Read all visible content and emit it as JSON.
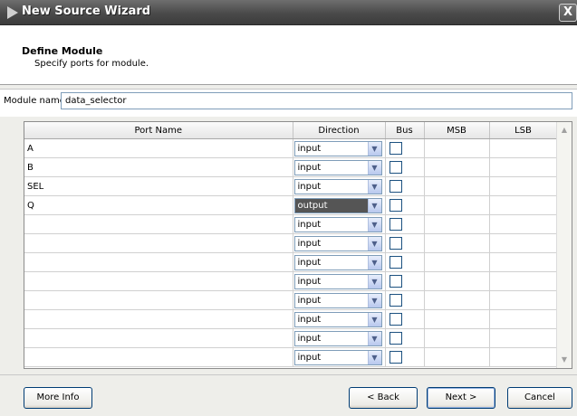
{
  "window": {
    "title": "New Source Wizard",
    "close_label": "X"
  },
  "header": {
    "title": "Define Module",
    "subtitle": "Specify ports for module."
  },
  "module_name": {
    "label": "Module name",
    "value": "data_selector"
  },
  "table": {
    "columns": [
      "Port Name",
      "Direction",
      "Bus",
      "MSB",
      "LSB"
    ],
    "rows": [
      {
        "port": "A",
        "direction": "input",
        "bus": false,
        "msb": "",
        "lsb": ""
      },
      {
        "port": "B",
        "direction": "input",
        "bus": false,
        "msb": "",
        "lsb": ""
      },
      {
        "port": "SEL",
        "direction": "input",
        "bus": false,
        "msb": "",
        "lsb": ""
      },
      {
        "port": "Q",
        "direction": "output",
        "bus": false,
        "msb": "",
        "lsb": "",
        "selected": true
      },
      {
        "port": "",
        "direction": "input",
        "bus": false,
        "msb": "",
        "lsb": ""
      },
      {
        "port": "",
        "direction": "input",
        "bus": false,
        "msb": "",
        "lsb": ""
      },
      {
        "port": "",
        "direction": "input",
        "bus": false,
        "msb": "",
        "lsb": ""
      },
      {
        "port": "",
        "direction": "input",
        "bus": false,
        "msb": "",
        "lsb": ""
      },
      {
        "port": "",
        "direction": "input",
        "bus": false,
        "msb": "",
        "lsb": ""
      },
      {
        "port": "",
        "direction": "input",
        "bus": false,
        "msb": "",
        "lsb": ""
      },
      {
        "port": "",
        "direction": "input",
        "bus": false,
        "msb": "",
        "lsb": ""
      },
      {
        "port": "",
        "direction": "input",
        "bus": false,
        "msb": "",
        "lsb": ""
      }
    ]
  },
  "buttons": {
    "more_info": "More Info",
    "back": "< Back",
    "next": "Next >",
    "cancel": "Cancel"
  },
  "icons": {
    "title": "wizard-arrow-icon",
    "dropdown": "chevron-down-icon",
    "close": "close-icon"
  }
}
